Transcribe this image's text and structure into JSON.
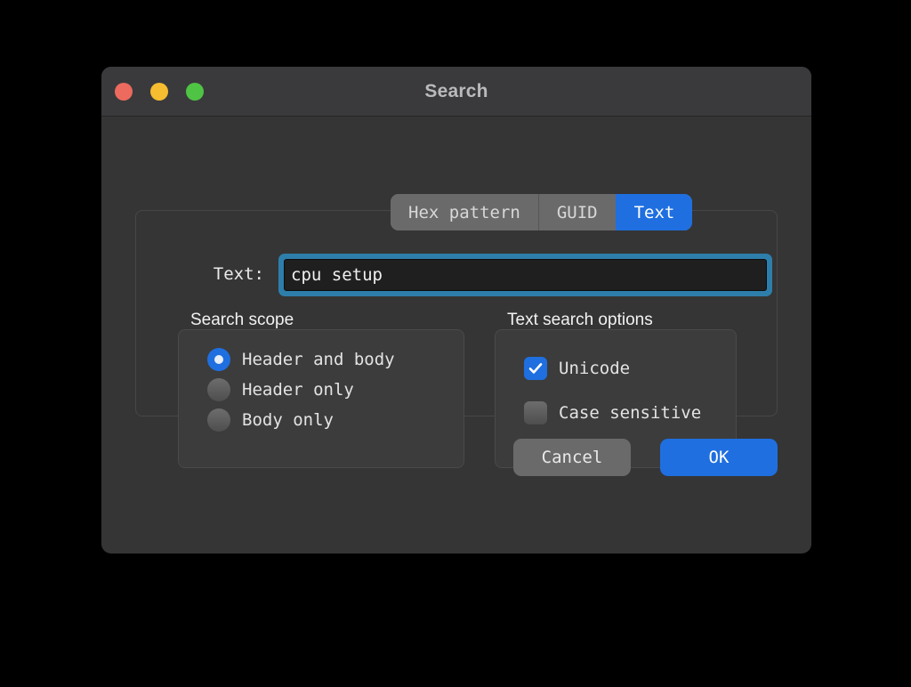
{
  "window": {
    "title": "Search",
    "traffic_lights": [
      {
        "name": "close",
        "color": "#ec6a5e"
      },
      {
        "name": "minimize",
        "color": "#f6bd30"
      },
      {
        "name": "zoom",
        "color": "#4fc444"
      }
    ]
  },
  "tabs": [
    {
      "label": "Hex pattern",
      "active": false
    },
    {
      "label": "GUID",
      "active": false
    },
    {
      "label": "Text",
      "active": true
    }
  ],
  "form": {
    "text_label": "Text:",
    "text_value": "cpu setup",
    "text_placeholder": ""
  },
  "scope": {
    "title": "Search scope",
    "options": [
      {
        "label": "Header and body",
        "selected": true
      },
      {
        "label": "Header only",
        "selected": false
      },
      {
        "label": "Body only",
        "selected": false
      }
    ]
  },
  "options": {
    "title": "Text search options",
    "items": [
      {
        "label": "Unicode",
        "checked": true
      },
      {
        "label": "Case sensitive",
        "checked": false
      }
    ]
  },
  "footer": {
    "cancel_label": "Cancel",
    "ok_label": "OK"
  },
  "colors": {
    "accent": "#1f6fe0",
    "window_bg": "#353535",
    "titlebar_bg": "#3a3a3c",
    "groupbox_bg": "#3c3c3c",
    "tab_bg": "#6a6a6a",
    "input_bg": "#1f1f1f",
    "focus_ring": "#2e7eab"
  }
}
